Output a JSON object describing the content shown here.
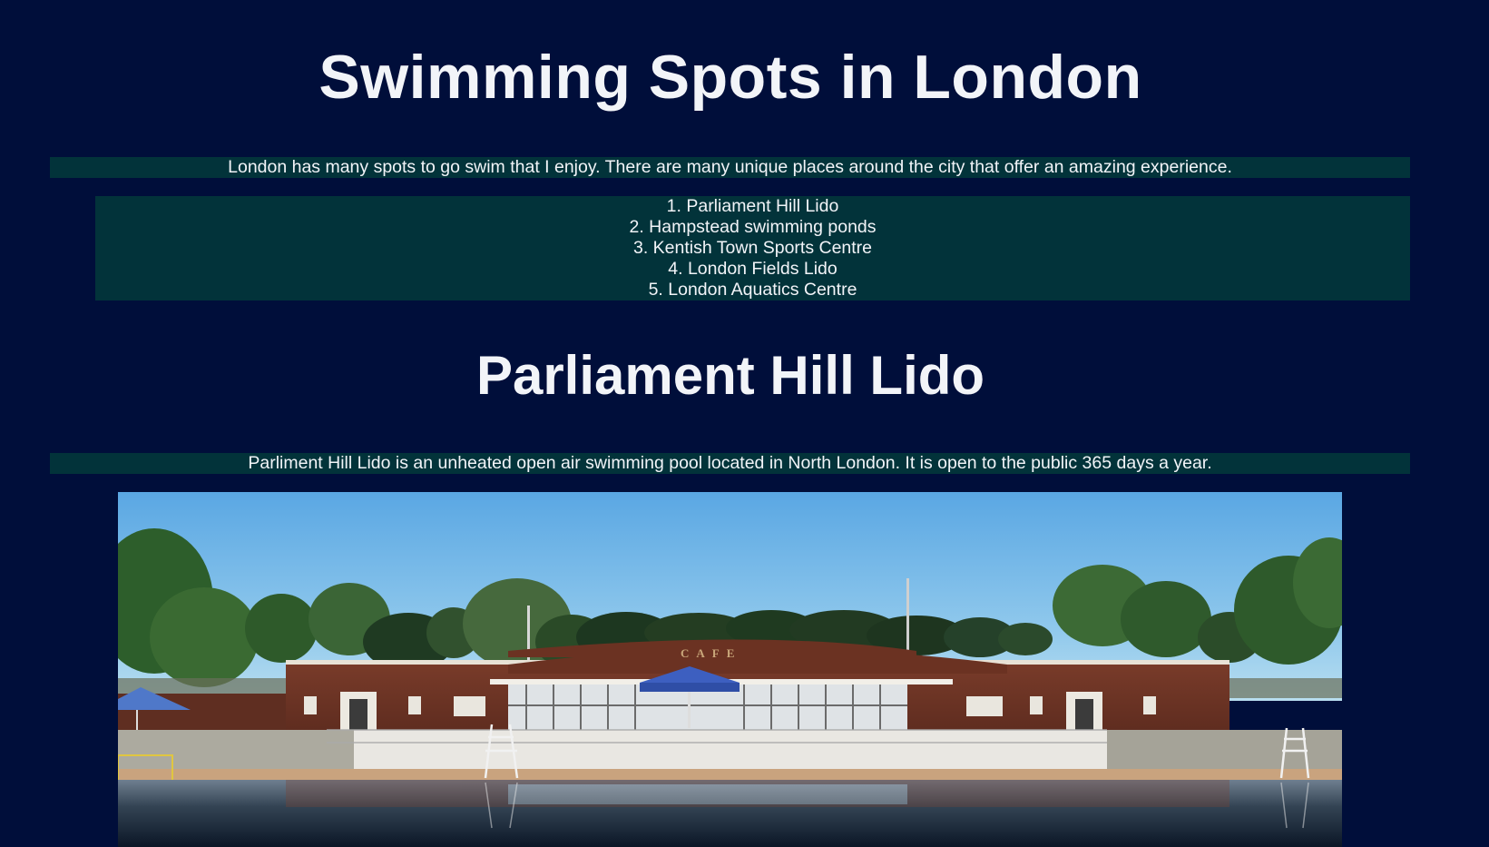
{
  "page": {
    "title": "Swimming Spots in London",
    "intro": "London has many spots to go swim that I enjoy. There are many unique places around the city that offer an amazing experience."
  },
  "spots": [
    "1. Parliament Hill Lido",
    "2. Hampstead swimming ponds",
    "3. Kentish Town Sports Centre",
    "4. London Fields Lido",
    "5. London Aquatics Centre"
  ],
  "section": {
    "title": "Parliament Hill Lido",
    "description": "Parliment Hill Lido is an unheated open air swimming pool located in North London. It is open to the public 365 days a year.",
    "photo": {
      "building_sign": "CAFE"
    }
  },
  "colors": {
    "page_background": "#000e3a",
    "text_box_background": "#02333a",
    "text": "#f2f4f8"
  }
}
